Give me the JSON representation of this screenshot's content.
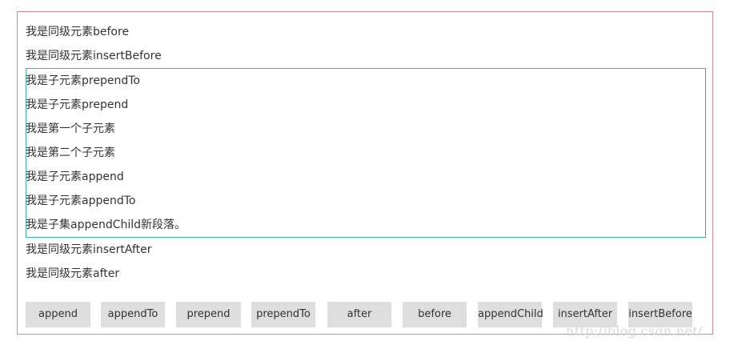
{
  "lines": [
    "我是同级元素before",
    "我是同级元素insertBefore",
    "我是子元素prependTo",
    "我是子元素prepend",
    "我是第一个子元素",
    "我是第二个子元素",
    "我是子元素append",
    "我是子元素appendTo",
    "我是子集appendChild新段落。",
    "我是同级元素insertAfter",
    "我是同级元素after"
  ],
  "buttons": [
    "append",
    "appendTo",
    "prepend",
    "prependTo",
    "after",
    "before",
    "appendChild",
    "insertAfter",
    "insertBefore"
  ],
  "watermark": "http://blog.csdn.net/",
  "colors": {
    "outer_border": "#d9878f",
    "child_border": "#3aaea0",
    "button_bg": "#dedede",
    "text": "#333333"
  }
}
